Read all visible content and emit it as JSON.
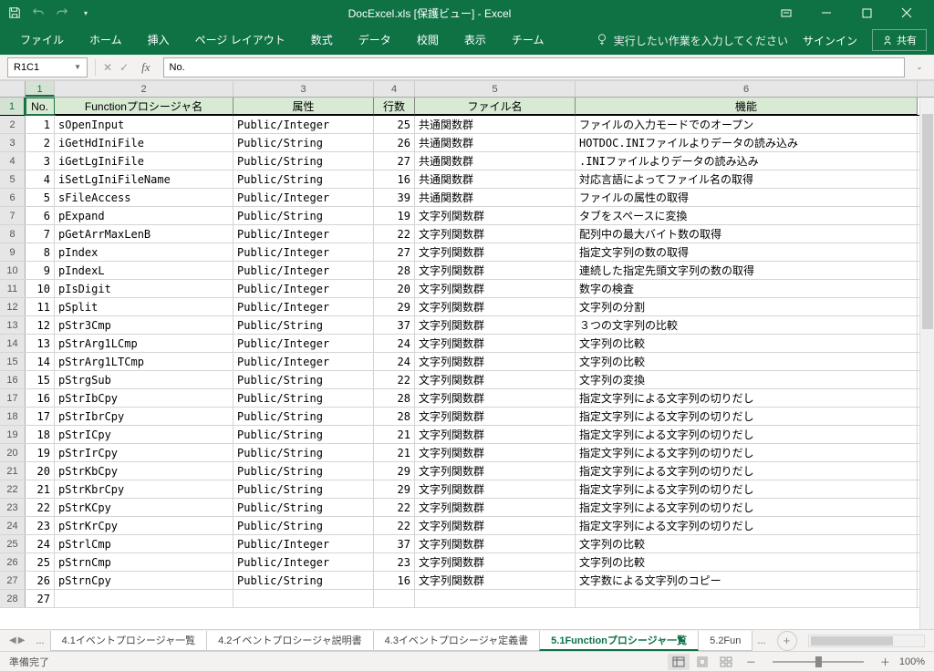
{
  "titlebar": {
    "title": "DocExcel.xls [保護ビュー] - Excel"
  },
  "ribbon": {
    "tabs": [
      "ファイル",
      "ホーム",
      "挿入",
      "ページ レイアウト",
      "数式",
      "データ",
      "校閲",
      "表示",
      "チーム"
    ],
    "tellme": "実行したい作業を入力してください",
    "signin": "サインイン",
    "share": "共有"
  },
  "formula_bar": {
    "name": "R1C1",
    "value": "No."
  },
  "columns": [
    "1",
    "2",
    "3",
    "4",
    "5",
    "6"
  ],
  "headers": [
    "No.",
    "Functionプロシージャ名",
    "属性",
    "行数",
    "ファイル名",
    "機能"
  ],
  "rows": [
    {
      "n": 1,
      "name": "sOpenInput",
      "attr": "Public/Integer",
      "lines": 25,
      "file": "共通関数群",
      "desc": "ファイルの入力モードでのオープン"
    },
    {
      "n": 2,
      "name": "iGetHdIniFile",
      "attr": "Public/String",
      "lines": 26,
      "file": "共通関数群",
      "desc": "HOTDOC.INIファイルよりデータの読み込み"
    },
    {
      "n": 3,
      "name": "iGetLgIniFile",
      "attr": "Public/String",
      "lines": 27,
      "file": "共通関数群",
      "desc": ".INIファイルよりデータの読み込み"
    },
    {
      "n": 4,
      "name": "iSetLgIniFileName",
      "attr": "Public/String",
      "lines": 16,
      "file": "共通関数群",
      "desc": "対応言語によってファイル名の取得"
    },
    {
      "n": 5,
      "name": "sFileAccess",
      "attr": "Public/Integer",
      "lines": 39,
      "file": "共通関数群",
      "desc": "ファイルの属性の取得"
    },
    {
      "n": 6,
      "name": "pExpand",
      "attr": "Public/String",
      "lines": 19,
      "file": "文字列関数群",
      "desc": "タブをスペースに変換"
    },
    {
      "n": 7,
      "name": "pGetArrMaxLenB",
      "attr": "Public/Integer",
      "lines": 22,
      "file": "文字列関数群",
      "desc": "配列中の最大バイト数の取得"
    },
    {
      "n": 8,
      "name": "pIndex",
      "attr": "Public/Integer",
      "lines": 27,
      "file": "文字列関数群",
      "desc": "指定文字列の数の取得"
    },
    {
      "n": 9,
      "name": "pIndexL",
      "attr": "Public/Integer",
      "lines": 28,
      "file": "文字列関数群",
      "desc": "連続した指定先頭文字列の数の取得"
    },
    {
      "n": 10,
      "name": "pIsDigit",
      "attr": "Public/Integer",
      "lines": 20,
      "file": "文字列関数群",
      "desc": "数字の検査"
    },
    {
      "n": 11,
      "name": "pSplit",
      "attr": "Public/Integer",
      "lines": 29,
      "file": "文字列関数群",
      "desc": "文字列の分割"
    },
    {
      "n": 12,
      "name": "pStr3Cmp",
      "attr": "Public/String",
      "lines": 37,
      "file": "文字列関数群",
      "desc": "３つの文字列の比較"
    },
    {
      "n": 13,
      "name": "pStrArg1LCmp",
      "attr": "Public/Integer",
      "lines": 24,
      "file": "文字列関数群",
      "desc": "文字列の比較"
    },
    {
      "n": 14,
      "name": "pStrArg1LTCmp",
      "attr": "Public/Integer",
      "lines": 24,
      "file": "文字列関数群",
      "desc": "文字列の比較"
    },
    {
      "n": 15,
      "name": "pStrgSub",
      "attr": "Public/String",
      "lines": 22,
      "file": "文字列関数群",
      "desc": "文字列の変換"
    },
    {
      "n": 16,
      "name": "pStrIbCpy",
      "attr": "Public/String",
      "lines": 28,
      "file": "文字列関数群",
      "desc": "指定文字列による文字列の切りだし"
    },
    {
      "n": 17,
      "name": "pStrIbrCpy",
      "attr": "Public/String",
      "lines": 28,
      "file": "文字列関数群",
      "desc": "指定文字列による文字列の切りだし"
    },
    {
      "n": 18,
      "name": "pStrICpy",
      "attr": "Public/String",
      "lines": 21,
      "file": "文字列関数群",
      "desc": "指定文字列による文字列の切りだし"
    },
    {
      "n": 19,
      "name": "pStrIrCpy",
      "attr": "Public/String",
      "lines": 21,
      "file": "文字列関数群",
      "desc": "指定文字列による文字列の切りだし"
    },
    {
      "n": 20,
      "name": "pStrKbCpy",
      "attr": "Public/String",
      "lines": 29,
      "file": "文字列関数群",
      "desc": "指定文字列による文字列の切りだし"
    },
    {
      "n": 21,
      "name": "pStrKbrCpy",
      "attr": "Public/String",
      "lines": 29,
      "file": "文字列関数群",
      "desc": "指定文字列による文字列の切りだし"
    },
    {
      "n": 22,
      "name": "pStrKCpy",
      "attr": "Public/String",
      "lines": 22,
      "file": "文字列関数群",
      "desc": "指定文字列による文字列の切りだし"
    },
    {
      "n": 23,
      "name": "pStrKrCpy",
      "attr": "Public/String",
      "lines": 22,
      "file": "文字列関数群",
      "desc": "指定文字列による文字列の切りだし"
    },
    {
      "n": 24,
      "name": "pStrlCmp",
      "attr": "Public/Integer",
      "lines": 37,
      "file": "文字列関数群",
      "desc": "文字列の比較"
    },
    {
      "n": 25,
      "name": "pStrnCmp",
      "attr": "Public/Integer",
      "lines": 23,
      "file": "文字列関数群",
      "desc": "文字列の比較"
    },
    {
      "n": 26,
      "name": "pStrnCpy",
      "attr": "Public/String",
      "lines": 16,
      "file": "文字列関数群",
      "desc": "文字数による文字列のコピー"
    },
    {
      "n": 27,
      "name": "",
      "attr": "",
      "lines": "",
      "file": "",
      "desc": ""
    }
  ],
  "sheets": {
    "tabs": [
      "4.1イベントプロシージャ一覧",
      "4.2イベントプロシージャ説明書",
      "4.3イベントプロシージャ定義書",
      "5.1Functionプロシージャ一覧",
      "5.2Fun"
    ],
    "active": 3,
    "more": "...",
    "more2": "..."
  },
  "status": {
    "ready": "準備完了",
    "zoom": "100%",
    "minus": "－",
    "plus": "＋"
  }
}
